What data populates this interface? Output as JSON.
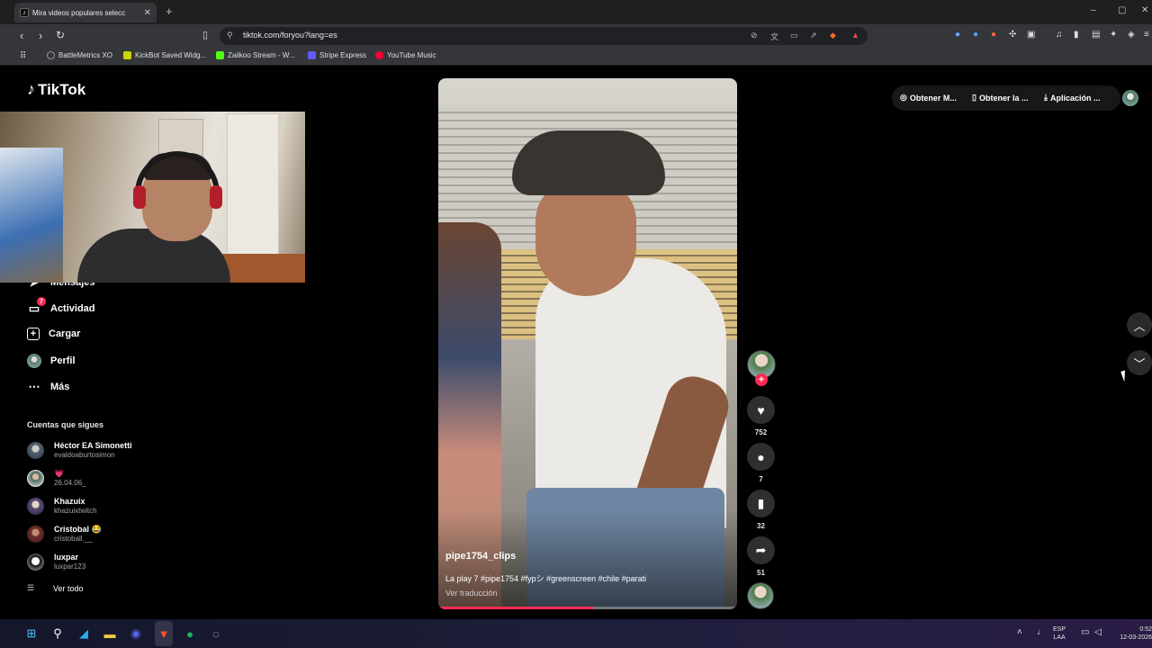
{
  "browser": {
    "tab_title": "Mira videos populares selecc",
    "tab_icon": "tiktok-icon",
    "new_tab_symbol": "+",
    "url": "tiktok.com/foryou?lang=es",
    "window_controls": {
      "minimize": "–",
      "restore": "▢",
      "close": "✕"
    }
  },
  "bookmarks": [
    {
      "label": "BattleMetrics XO",
      "icon": "search-icon",
      "color": "#888888"
    },
    {
      "label": "KickBot Saved Widg...",
      "icon": "kickbot-icon",
      "color": "#53fc18"
    },
    {
      "label": "Zaiikoo Stream - W...",
      "icon": "kick-icon",
      "color": "#53fc18"
    },
    {
      "label": "Stripe Express",
      "icon": "stripe-icon",
      "color": "#635bff"
    },
    {
      "label": "YouTube Music",
      "icon": "youtube-music-icon",
      "color": "#ff0033"
    }
  ],
  "tiktok": {
    "logo_text": "TikTok",
    "nav": {
      "messages": "Mensajes",
      "activity": "Actividad",
      "activity_badge": "7",
      "upload": "Cargar",
      "profile": "Perfil",
      "more": "Más"
    },
    "following_title": "Cuentas que sigues",
    "accounts": [
      {
        "name": "Héctor EA Simonetti",
        "username": "evaldoaburtosimon"
      },
      {
        "name": "💗",
        "username": "26.04.06_"
      },
      {
        "name": "Khazuix",
        "username": "khazuixtwitch"
      },
      {
        "name": "Cristobal 😂",
        "username": "cristoball.__"
      },
      {
        "name": "luxpar",
        "username": "luxpar123"
      }
    ],
    "see_all": "Ver todo",
    "video": {
      "author": "pipe1754_clips",
      "caption": "La play 7 #pipe1754 #fypシ #greenscreen #chile #parati",
      "translate": "Ver traducción",
      "progress": 0.52
    },
    "actions": {
      "likes": "752",
      "comments": "7",
      "saves": "32",
      "shares": "51"
    },
    "top_right": {
      "item1": "Obtener M...",
      "item2": "Obtener la ...",
      "item3": "Aplicación ..."
    }
  },
  "taskbar": {
    "lang_top": "ESP",
    "lang_bottom": "LAA",
    "time": "0:52",
    "date": "12-03-2026"
  }
}
